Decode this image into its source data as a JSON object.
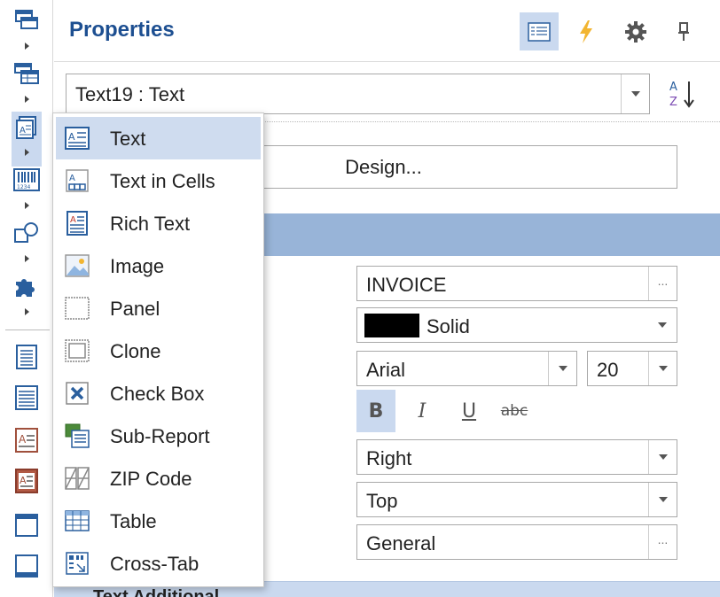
{
  "panel_title": "Properties",
  "header_buttons": [
    {
      "name": "properties-view-icon",
      "active": true
    },
    {
      "name": "events-lightning-icon"
    },
    {
      "name": "settings-gear-icon"
    },
    {
      "name": "pin-icon"
    }
  ],
  "object_selector": {
    "value": "Text19 : Text"
  },
  "sort_button": {
    "icon": "sort-az-icon"
  },
  "design_button": {
    "label": "Design..."
  },
  "properties": {
    "text": {
      "value": "INVOICE",
      "ellipsis": "..."
    },
    "border": {
      "color": "#000000",
      "value": "Solid"
    },
    "font_name": {
      "value": "Arial"
    },
    "font_size": {
      "value": "20"
    },
    "font_styles": {
      "bold": "B",
      "italic": "I",
      "underline": "U",
      "strikeout": "abc",
      "bold_active": true
    },
    "horz_alignment": {
      "value": "Right"
    },
    "vert_alignment": {
      "value": "Top"
    },
    "text_format": {
      "value": "General",
      "ellipsis": "..."
    }
  },
  "next_category": {
    "label": "Text Additional"
  },
  "toolbox": {
    "items": [
      "band-icon",
      "databand-icon",
      "text-component-icon",
      "barcode-icon",
      "shapes-icon",
      "puzzle-components-icon",
      "page-icon",
      "report-page-icon",
      "text-icon",
      "rich-text-icon",
      "panel-icon",
      "window-icon"
    ],
    "selected": "text-component-icon"
  },
  "dropdown_menu": {
    "items": [
      {
        "label": "Text",
        "icon": "text-icon",
        "highlighted": true
      },
      {
        "label": "Text in Cells",
        "icon": "text-in-cells-icon"
      },
      {
        "label": "Rich Text",
        "icon": "rich-text-icon"
      },
      {
        "label": "Image",
        "icon": "image-icon"
      },
      {
        "label": "Panel",
        "icon": "panel-icon"
      },
      {
        "label": "Clone",
        "icon": "clone-icon"
      },
      {
        "label": "Check Box",
        "icon": "check-box-icon"
      },
      {
        "label": "Sub-Report",
        "icon": "sub-report-icon"
      },
      {
        "label": "ZIP Code",
        "icon": "zip-code-icon"
      },
      {
        "label": "Table",
        "icon": "table-icon"
      },
      {
        "label": "Cross-Tab",
        "icon": "cross-tab-icon"
      }
    ]
  },
  "colors": {
    "accent": "#1d4f91",
    "highlight": "#cad9ef",
    "category_bar": "#98b4d8"
  }
}
